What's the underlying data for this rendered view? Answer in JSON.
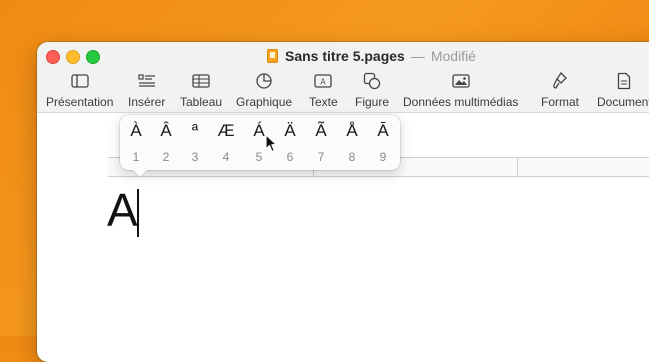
{
  "window": {
    "doc_name": "Sans titre 5.pages",
    "separator": "—",
    "status": "Modifié"
  },
  "toolbar": {
    "items": [
      {
        "label": "Présentation",
        "icon": "sidebar-icon"
      },
      {
        "label": "Insérer",
        "icon": "insert-list-icon"
      },
      {
        "label": "Tableau",
        "icon": "table-icon"
      },
      {
        "label": "Graphique",
        "icon": "chart-icon"
      },
      {
        "label": "Texte",
        "icon": "textbox-icon"
      },
      {
        "label": "Figure",
        "icon": "shape-icon"
      },
      {
        "label": "Données multimédias",
        "icon": "media-icon"
      },
      {
        "label": "Format",
        "icon": "paintbrush-icon"
      },
      {
        "label": "Document",
        "icon": "document-icon"
      }
    ]
  },
  "document": {
    "typed_text": "A"
  },
  "accent_popup": {
    "options": [
      {
        "char": "À",
        "key": "1"
      },
      {
        "char": "Â",
        "key": "2"
      },
      {
        "char": "ª",
        "key": "3"
      },
      {
        "char": "Æ",
        "key": "4"
      },
      {
        "char": "Á",
        "key": "5"
      },
      {
        "char": "Ä",
        "key": "6"
      },
      {
        "char": "Ã",
        "key": "7"
      },
      {
        "char": "Å",
        "key": "8"
      },
      {
        "char": "Ā",
        "key": "9"
      }
    ]
  }
}
